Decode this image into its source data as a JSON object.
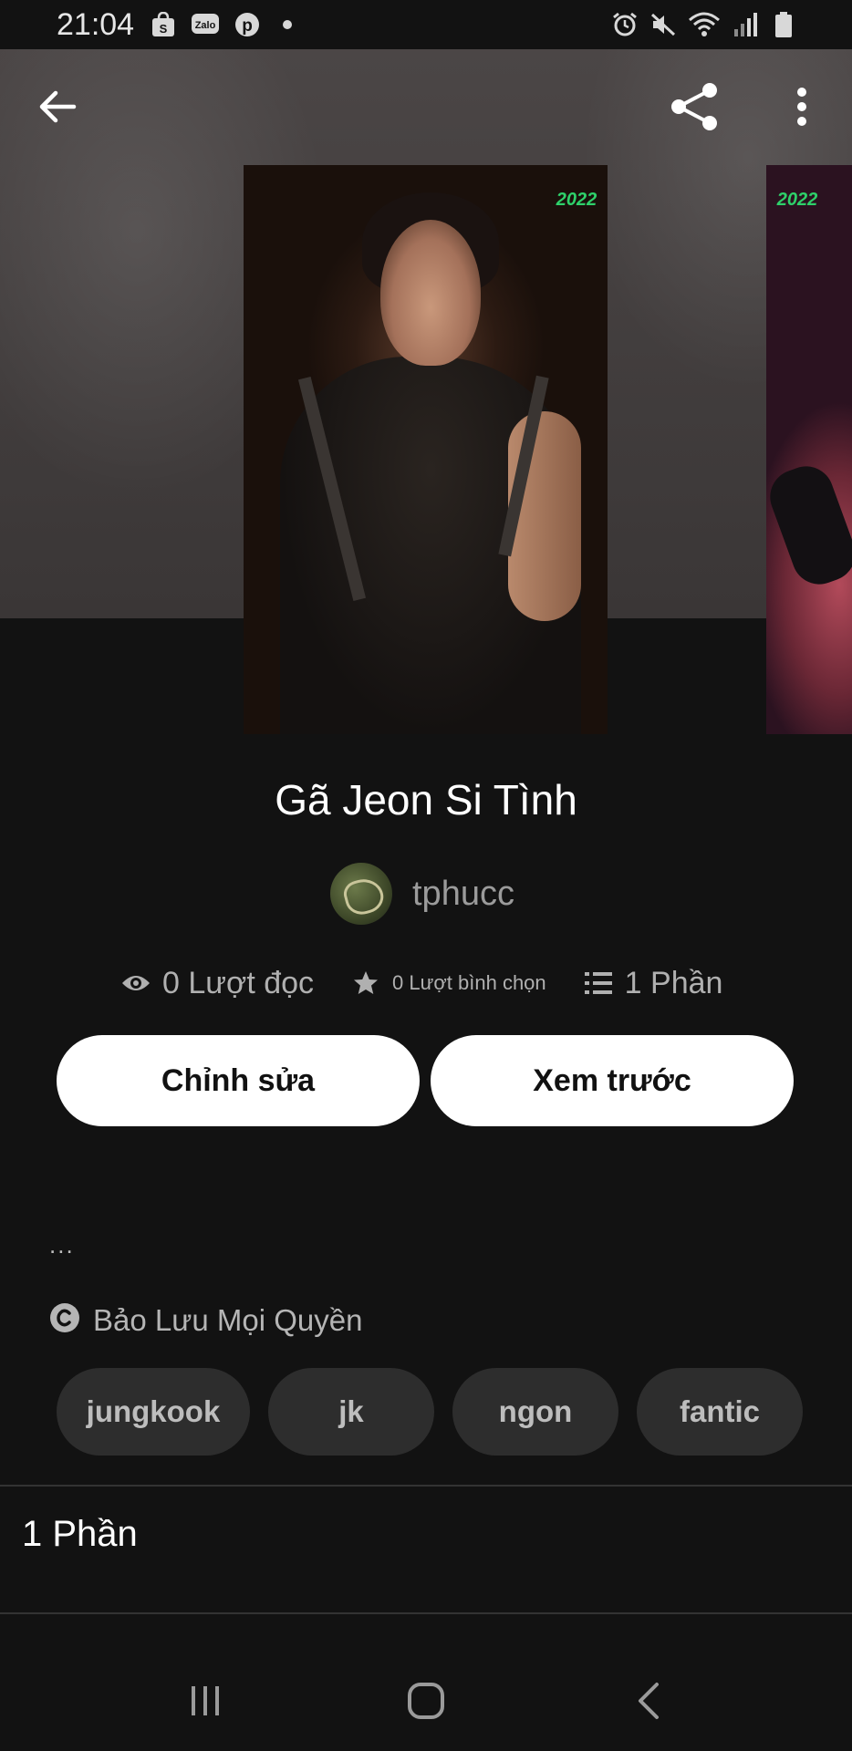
{
  "status_bar": {
    "time": "21:04",
    "left_icons": [
      "shopee-icon",
      "zalo-icon",
      "pinterest-icon",
      "dot-icon"
    ],
    "zalo_label": "Zalo",
    "right_icons": [
      "alarm-icon",
      "mute-icon",
      "wifi-icon",
      "signal-icon",
      "battery-icon"
    ]
  },
  "toolbar": {
    "back_icon": "arrow-left-icon",
    "share_icon": "share-icon",
    "more_icon": "more-vertical-icon"
  },
  "cover": {
    "badge_text": "2022"
  },
  "story": {
    "title": "Gã Jeon Si Tình",
    "author": "tphucc",
    "stats": {
      "reads": "0 Lượt đọc",
      "votes": "0 Lượt bình chọn",
      "parts": "1 Phần"
    }
  },
  "actions": {
    "edit_label": "Chỉnh sửa",
    "preview_label": "Xem trước"
  },
  "description": "...",
  "copyright": "Bảo Lưu Mọi Quyền",
  "tags": [
    "jungkook",
    "jk",
    "ngon",
    "fantic"
  ],
  "parts_heading": "1 Phần",
  "colors": {
    "background": "#121212",
    "button_bg": "#ffffff",
    "tag_bg": "#2d2d2d",
    "muted_text": "#b5b5b5"
  }
}
